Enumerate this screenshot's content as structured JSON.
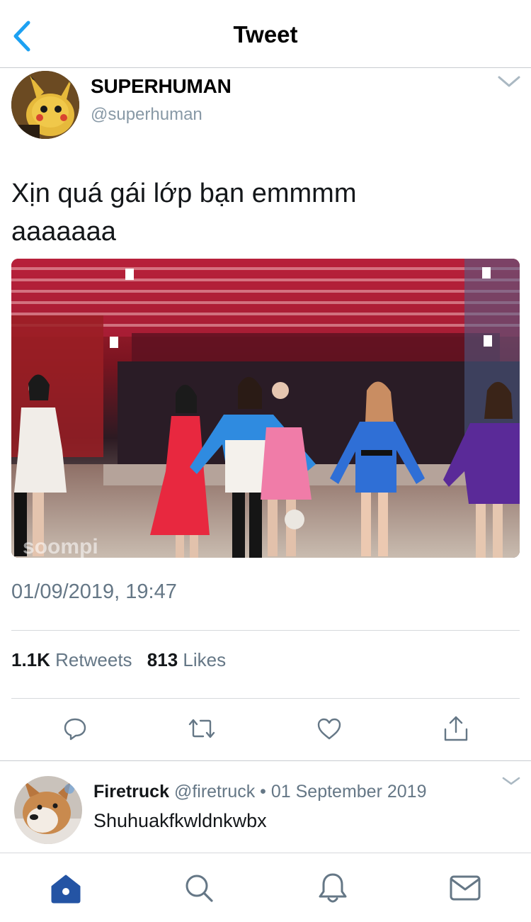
{
  "header": {
    "title": "Tweet",
    "back_icon": "chevron-left-icon"
  },
  "tweet": {
    "author_name": "SUPERHUMAN",
    "author_handle": "@superhuman",
    "text_line1": "Xịn quá gái lớp bạn emmmm",
    "text_line2": "aaaaaaa",
    "media_watermark": "soompi",
    "timestamp": "01/09/2019, 19:47",
    "retweets_count": "1.1K",
    "retweets_label": "Retweets",
    "likes_count": "813",
    "likes_label": "Likes"
  },
  "actions": [
    "reply-icon",
    "retweet-icon",
    "like-icon",
    "share-icon"
  ],
  "reply": {
    "name": "Firetruck",
    "meta": "@firetruck • 01 September 2019",
    "text": "Shuhuakfkwldnkwbx"
  },
  "tabbar": [
    "home-icon",
    "search-icon",
    "notifications-icon",
    "messages-icon"
  ],
  "colors": {
    "accent": "#1da1f2",
    "active_tab": "#2454a4",
    "secondary_text": "#657786",
    "icon_gray": "#657786"
  }
}
